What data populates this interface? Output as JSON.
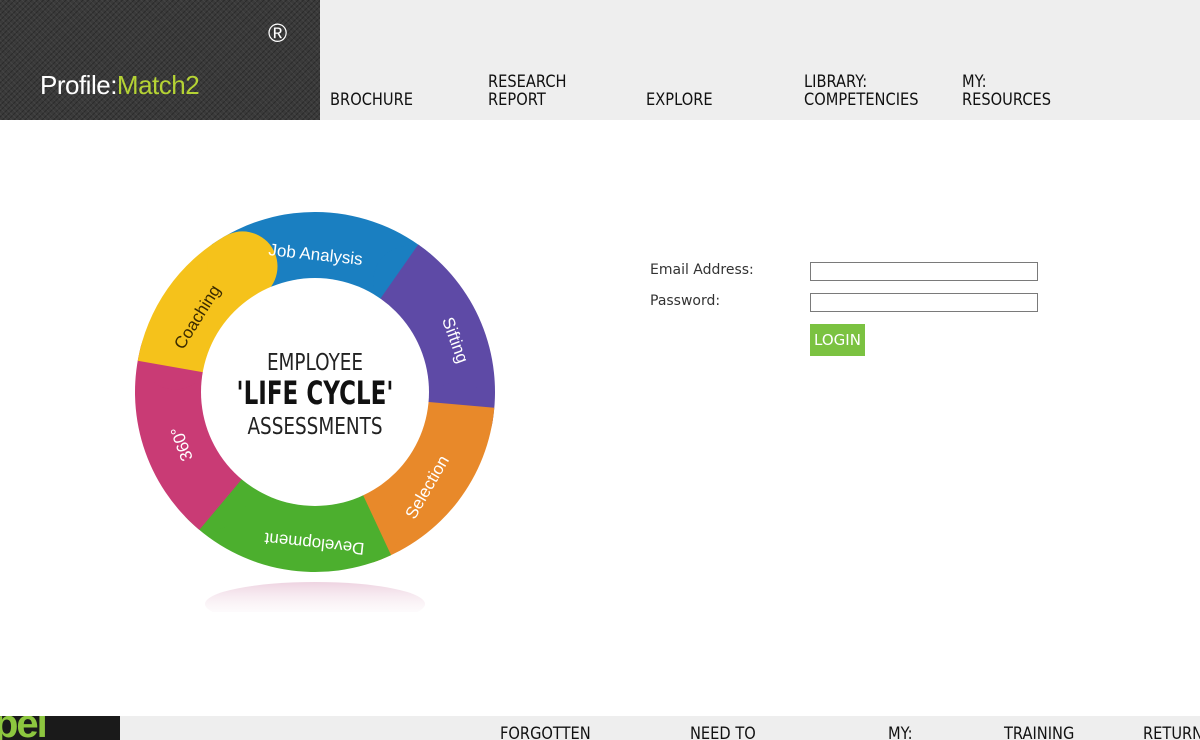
{
  "header": {
    "logo": {
      "part1": "Profile:",
      "part2": "Match2",
      "registered": "®"
    },
    "nav": [
      {
        "lines": [
          "BROCHURE"
        ]
      },
      {
        "lines": [
          "RESEARCH",
          "REPORT"
        ]
      },
      {
        "lines": [
          "EXPLORE"
        ]
      },
      {
        "lines": [
          "LIBRARY:",
          "COMPETENCIES"
        ]
      },
      {
        "lines": [
          "MY:",
          "RESOURCES"
        ]
      }
    ]
  },
  "graphic": {
    "center_lines": [
      "EMPLOYEE",
      "'LIFE CYCLE'",
      "ASSESSMENTS"
    ],
    "segments": [
      {
        "label": "Job Analysis",
        "color": "#1a7fc1"
      },
      {
        "label": "Sifting",
        "color": "#5e4aa6"
      },
      {
        "label": "Selection",
        "color": "#e8892a"
      },
      {
        "label": "Development",
        "color": "#4caf2e"
      },
      {
        "label": "360°",
        "color": "#c93b75"
      },
      {
        "label": "Coaching",
        "color": "#f5c21b"
      }
    ]
  },
  "login": {
    "email_label": "Email Address:",
    "email_value": "",
    "password_label": "Password:",
    "password_value": "",
    "button_label": "LOGIN"
  },
  "footer": {
    "logo_text": "pel",
    "items": [
      "FORGOTTEN",
      "NEED TO",
      "MY:",
      "TRAINING",
      "RETURN"
    ]
  },
  "colors": {
    "accent_green": "#7bc241",
    "logo_green": "#b5d334",
    "header_bg": "#eeeeee"
  }
}
